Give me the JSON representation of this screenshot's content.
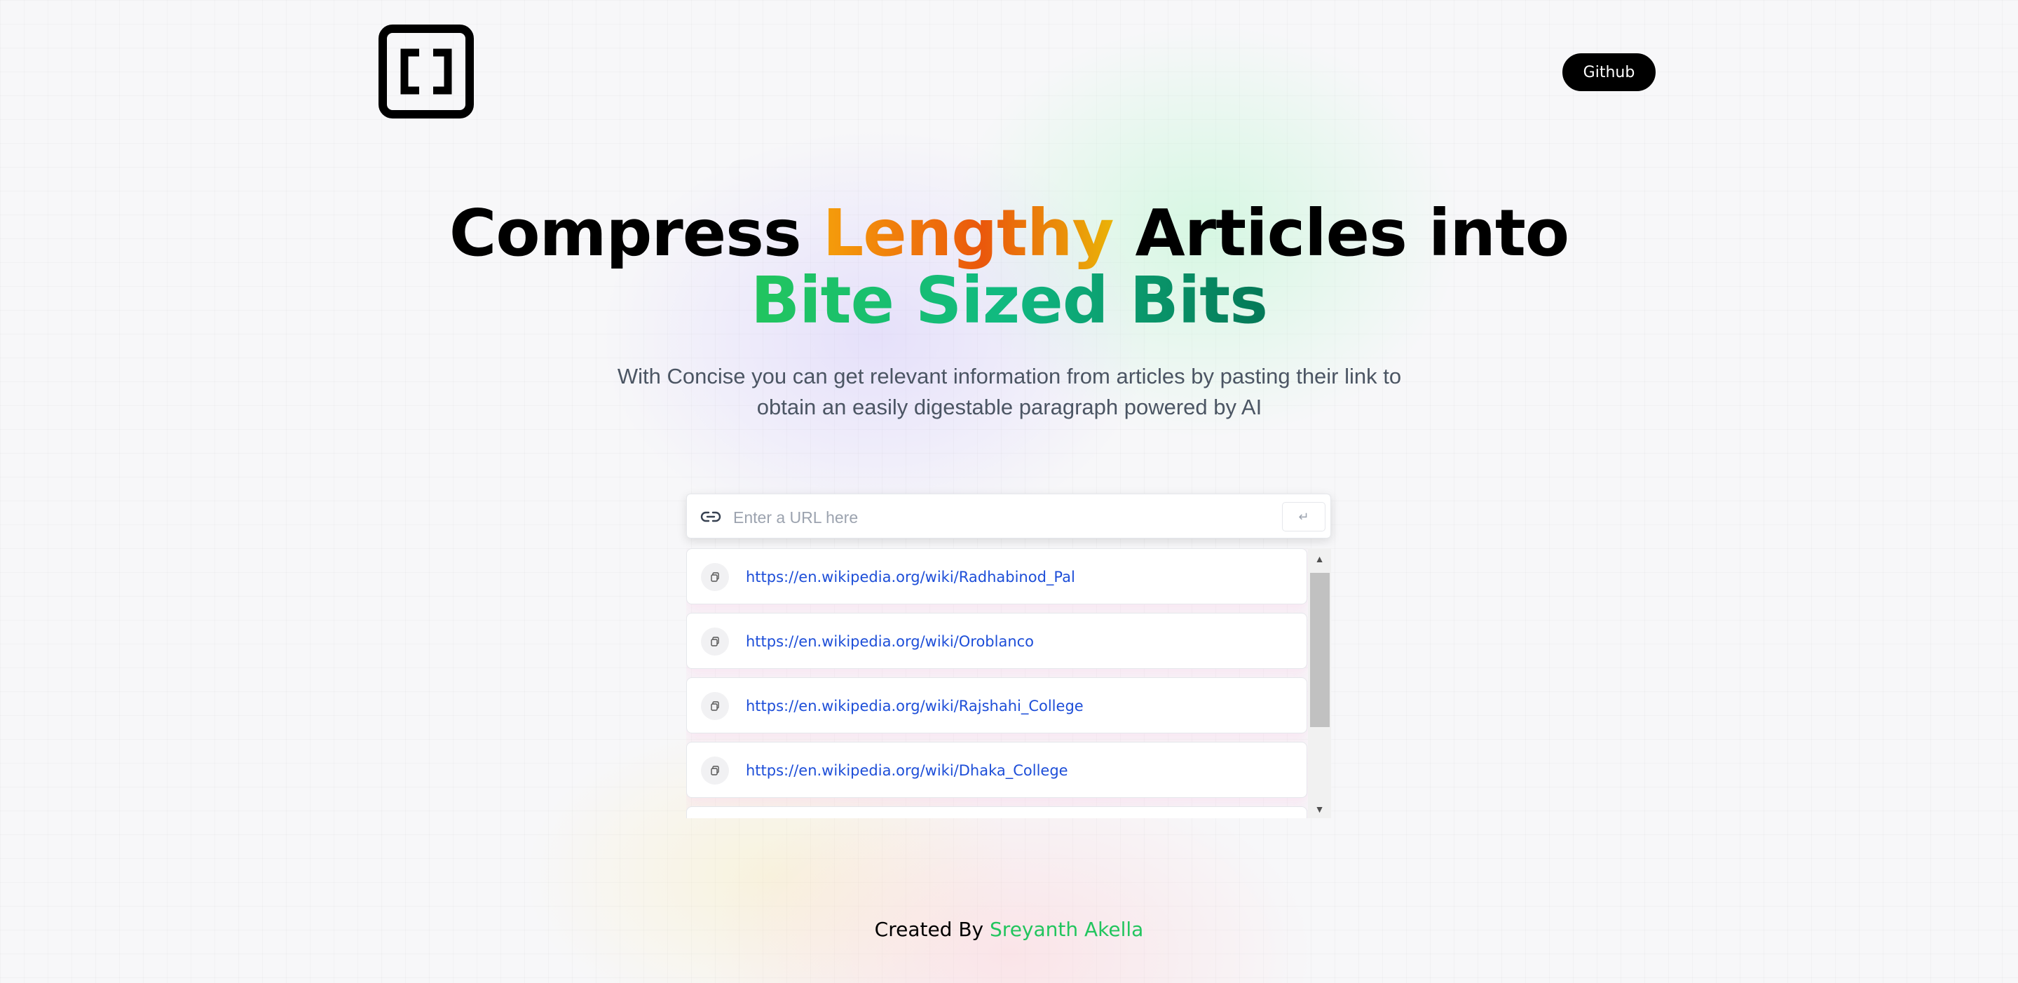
{
  "header": {
    "github_label": "Github"
  },
  "hero": {
    "title_part1": "Compress ",
    "title_highlight": "Lengthy",
    "title_part2": " Articles into",
    "title_line2": "Bite Sized Bits",
    "description": "With Concise you can get relevant information from articles by pasting their link to obtain an easily digestable paragraph powered by AI"
  },
  "search": {
    "placeholder": "Enter a URL here",
    "submit_symbol": "↵"
  },
  "history": {
    "items": [
      {
        "url": "https://en.wikipedia.org/wiki/Radhabinod_Pal"
      },
      {
        "url": "https://en.wikipedia.org/wiki/Oroblanco"
      },
      {
        "url": "https://en.wikipedia.org/wiki/Rajshahi_College"
      },
      {
        "url": "https://en.wikipedia.org/wiki/Dhaka_College"
      }
    ]
  },
  "footer": {
    "prefix": "Created By ",
    "author": "Sreyanth Akella"
  },
  "colors": {
    "accent_green": "#22c55e",
    "accent_orange": "#ea580c",
    "link_blue": "#1d4ed8"
  }
}
